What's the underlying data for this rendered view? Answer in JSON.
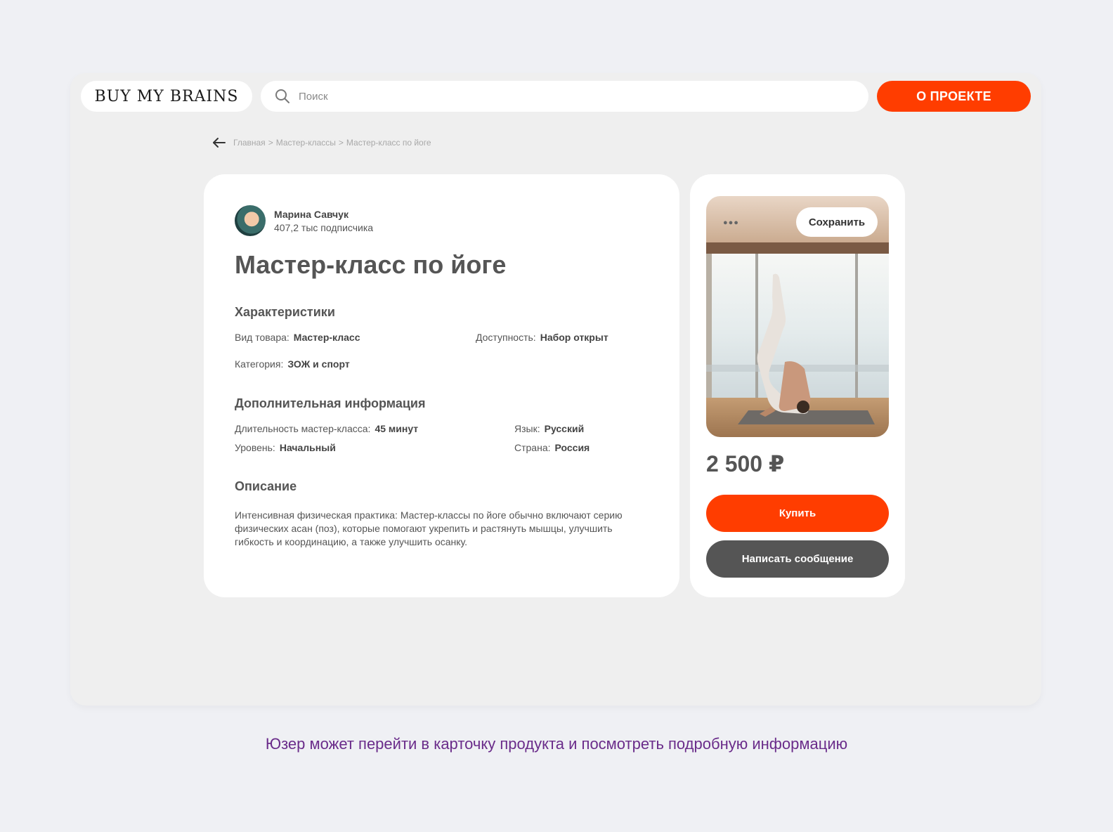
{
  "header": {
    "logo_text": "BUY MY BRAINS",
    "search_placeholder": "Поиск",
    "about_button": "О ПРОЕКТЕ"
  },
  "breadcrumb": {
    "items": [
      "Главная",
      "Мастер-классы",
      "Мастер-класс по йоге"
    ],
    "separator": ">"
  },
  "author": {
    "name": "Марина Савчук",
    "subscribers": "407,2 тыс подписчика"
  },
  "product": {
    "title": "Мастер-класс по йоге",
    "characteristics": {
      "heading": "Характеристики",
      "type_label": "Вид товара:",
      "type_value": "Мастер-класс",
      "availability_label": "Доступность:",
      "availability_value": "Набор открыт",
      "category_label": "Категория:",
      "category_value": "ЗОЖ и спорт"
    },
    "additional": {
      "heading": "Дополнительная информация",
      "duration_label": "Длительность мастер-класса:",
      "duration_value": "45 минут",
      "language_label": "Язык:",
      "language_value": "Русский",
      "level_label": "Уровень:",
      "level_value": "Начальный",
      "country_label": "Страна:",
      "country_value": "Россия"
    },
    "description": {
      "heading": "Описание",
      "text": "Интенсивная физическая практика: Мастер-классы по йоге обычно включают серию физических асан (поз), которые помогают укрепить и растянуть мышцы, улучшить гибкость и координацию, а также улучшить осанку."
    }
  },
  "side": {
    "save_button": "Сохранить",
    "price": "2 500 ₽",
    "buy_button": "Купить",
    "message_button": "Написать сообщение"
  },
  "caption": "Юзер может перейти в карточку продукта и посмотреть подробную информацию",
  "colors": {
    "accent": "#ff3d00",
    "dark_button": "#555555",
    "caption": "#6a2c8a"
  }
}
